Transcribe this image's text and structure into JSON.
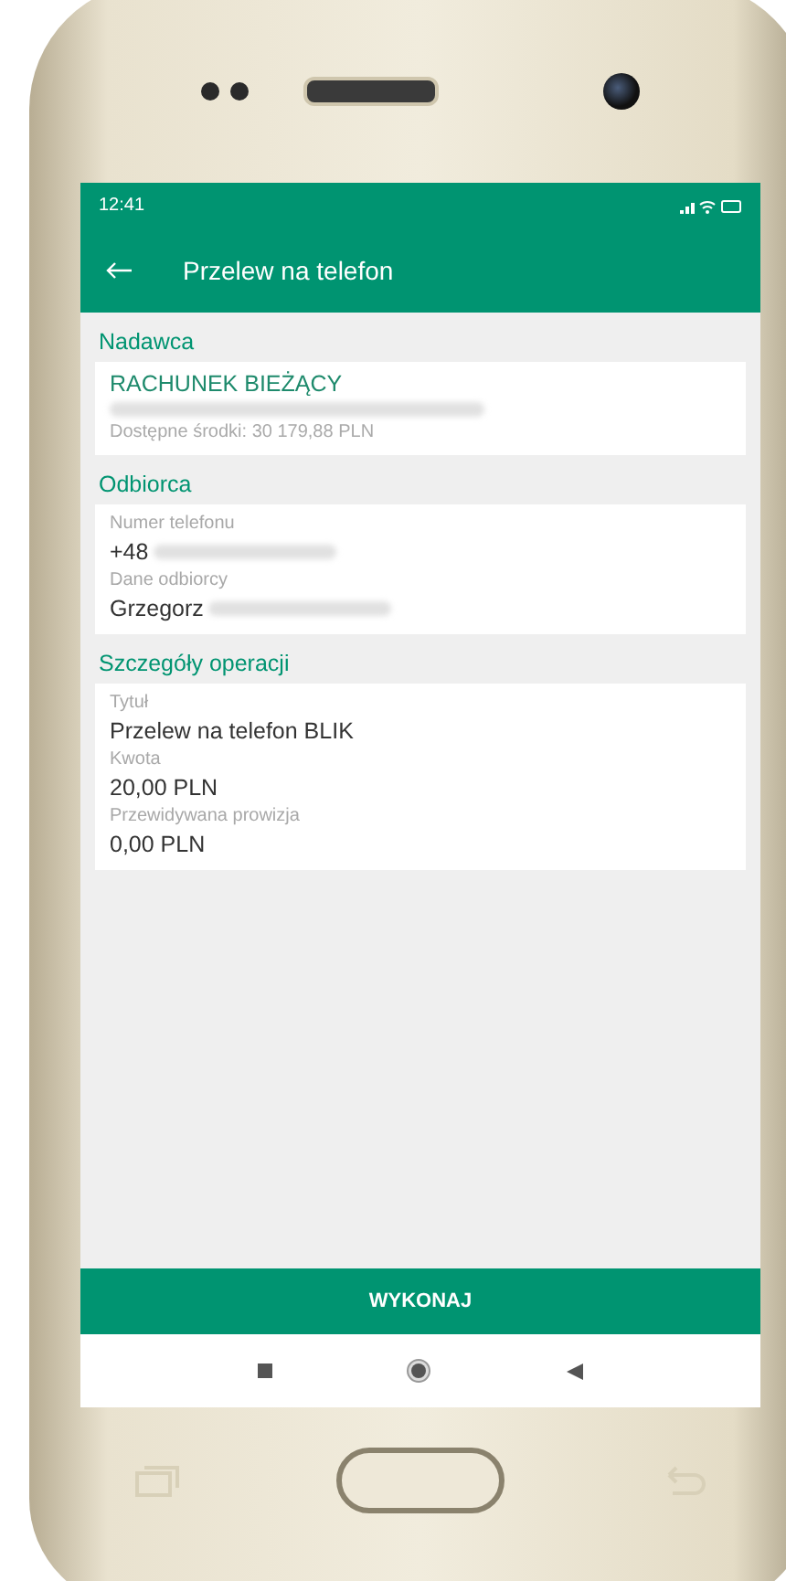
{
  "status_bar": {
    "time": "12:41"
  },
  "app_bar": {
    "title": "Przelew na telefon"
  },
  "sections": [
    {
      "title": "Nadawca",
      "fields": [
        {
          "kind": "account",
          "value": "RACHUNEK BIEŻĄCY"
        },
        {
          "kind": "redacted"
        },
        {
          "kind": "note",
          "value": "Dostępne środki: 30 179,88 PLN"
        }
      ]
    },
    {
      "title": "Odbiorca",
      "fields": [
        {
          "kind": "label",
          "value": "Numer telefonu"
        },
        {
          "kind": "value",
          "value": "+48",
          "redacted_suffix": true
        },
        {
          "kind": "label",
          "value": "Dane odbiorcy"
        },
        {
          "kind": "value",
          "value": "Grzegorz",
          "redacted_suffix": true
        }
      ]
    },
    {
      "title": "Szczegóły operacji",
      "fields": [
        {
          "kind": "label",
          "value": "Tytuł"
        },
        {
          "kind": "value",
          "value": "Przelew na telefon BLIK",
          "redacted_suffix": false
        },
        {
          "kind": "label",
          "value": "Kwota"
        },
        {
          "kind": "value",
          "value": "20,00 PLN",
          "redacted_suffix": false
        },
        {
          "kind": "label",
          "value": "Przewidywana prowizja"
        },
        {
          "kind": "value",
          "value": "0,00 PLN",
          "redacted_suffix": false
        }
      ]
    }
  ],
  "action_button": {
    "label": "WYKONAJ"
  }
}
